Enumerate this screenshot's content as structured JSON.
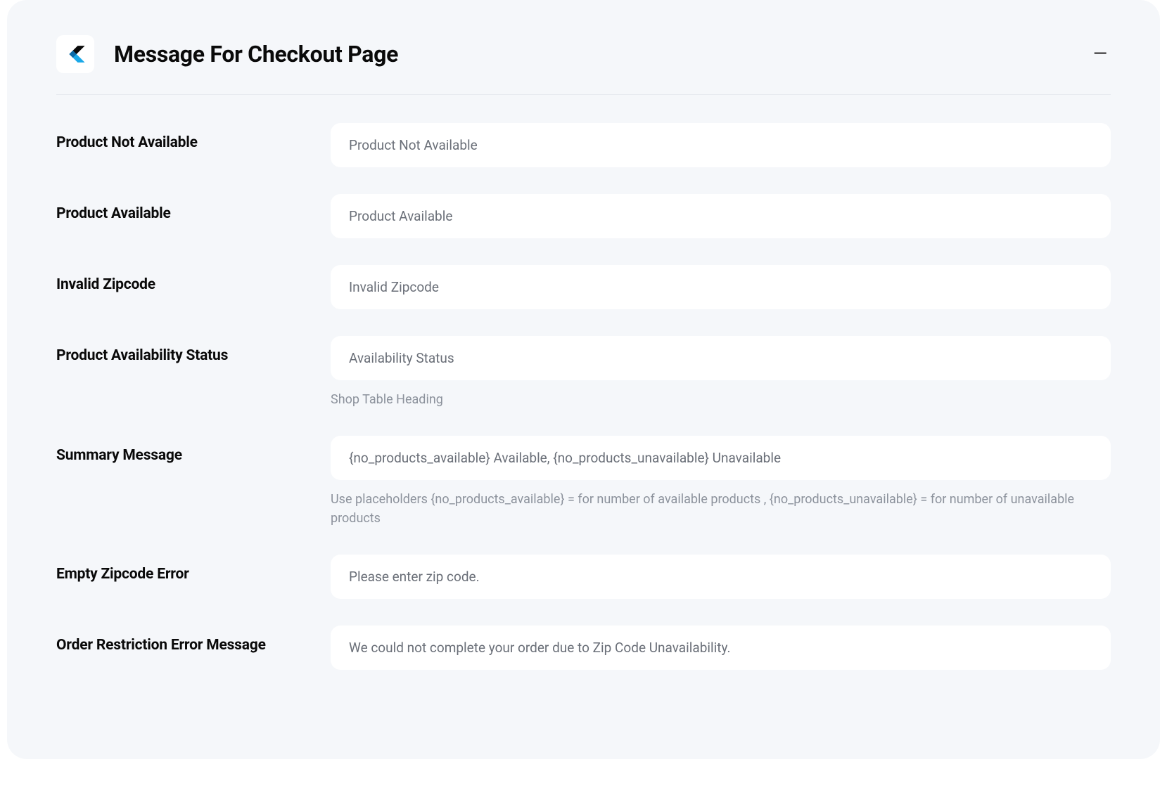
{
  "header": {
    "title": "Message For Checkout Page"
  },
  "fields": {
    "product_not_available": {
      "label": "Product Not Available",
      "value": "Product Not Available"
    },
    "product_available": {
      "label": "Product Available",
      "value": "Product Available"
    },
    "invalid_zipcode": {
      "label": "Invalid Zipcode",
      "value": "Invalid Zipcode"
    },
    "product_availability_status": {
      "label": "Product Availability Status",
      "value": "Availability Status",
      "helper": "Shop Table Heading"
    },
    "summary_message": {
      "label": "Summary Message",
      "value": "{no_products_available} Available, {no_products_unavailable} Unavailable",
      "helper": "Use placeholders {no_products_available} = for number of available products , {no_products_unavailable} = for number of unavailable products"
    },
    "empty_zipcode_error": {
      "label": "Empty Zipcode Error",
      "value": "Please enter zip code."
    },
    "order_restriction_error": {
      "label": "Order Restriction Error Message",
      "value": "We could not complete your order due to Zip Code Unavailability."
    }
  }
}
